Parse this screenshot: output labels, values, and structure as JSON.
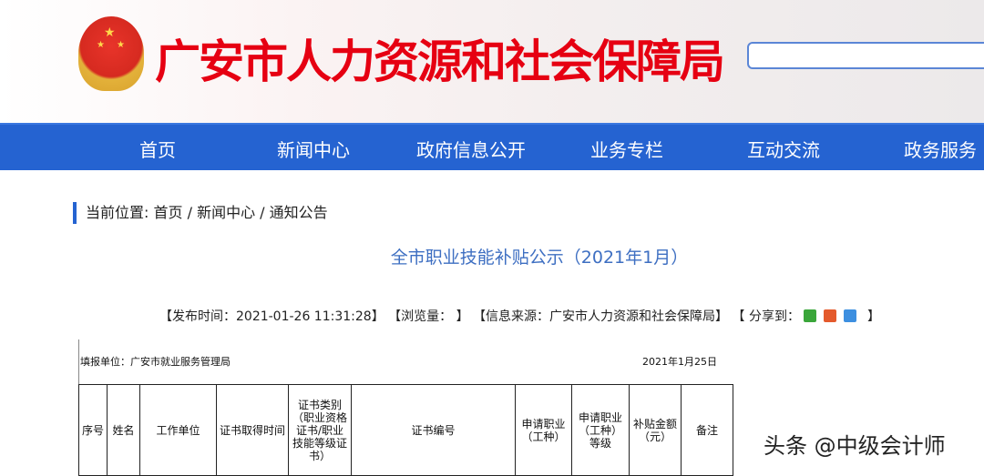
{
  "header": {
    "site_title": "广安市人力资源和社会保障局",
    "search_placeholder": ""
  },
  "nav": [
    "首页",
    "新闻中心",
    "政府信息公开",
    "业务专栏",
    "互动交流",
    "政务服务"
  ],
  "breadcrumb": {
    "label": "当前位置:",
    "path": "首页 / 新闻中心 / 通知公告"
  },
  "article": {
    "title": "全市职业技能补贴公示（2021年1月）",
    "publish": "【发布时间：2021-01-26 11:31:28】",
    "views": "【浏览量：  】",
    "source": "【信息来源：广安市人力资源和社会保障局】",
    "share": "【 分享到：",
    "share_end": "】"
  },
  "sheet": {
    "fill_unit": "填报单位：广安市就业服务管理局",
    "date": "2021年1月25日",
    "columns": [
      "序号",
      "姓名",
      "工作单位",
      "证书取得时间",
      "证书类别（职业资格证书/职业技能等级证书）",
      "证书编号",
      "申请职业（工种）",
      "申请职业（工种）等级",
      "补贴金额（元）",
      "备注"
    ]
  },
  "watermark": "头条 @中级会计师",
  "colors": {
    "nav": "#2563d1",
    "title": "#e60012",
    "link": "#3e6fc2"
  }
}
